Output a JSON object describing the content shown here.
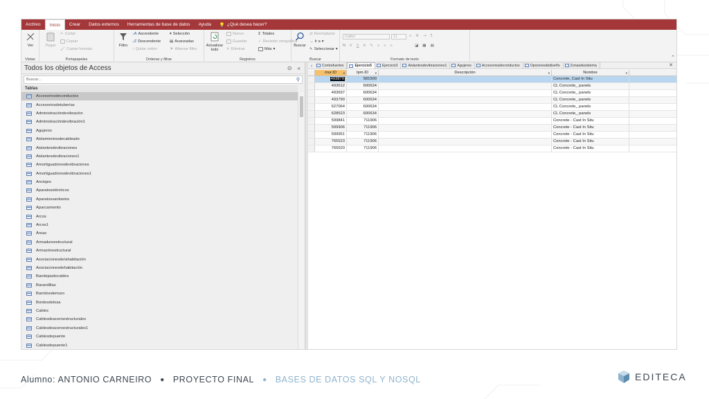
{
  "menubar": {
    "items": [
      "Archivo",
      "Inicio",
      "Crear",
      "Datos externos",
      "Herramientas de base de datos",
      "Ayuda"
    ],
    "active": "Inicio",
    "tell_me": "¿Qué desea hacer?"
  },
  "ribbon": {
    "vistas": {
      "label": "Vistas",
      "ver": "Ver"
    },
    "portapapeles": {
      "label": "Portapapeles",
      "pegar": "Pegar",
      "cortar": "Cortar",
      "copiar": "Copiar",
      "copiar_formato": "Copiar formato"
    },
    "ordenar": {
      "label": "Ordenar y filtrar",
      "filtro": "Filtro",
      "ascendente": "Ascendente",
      "descendente": "Descendente",
      "quitar_orden": "Quitar orden",
      "seleccion": "Selección",
      "avanzadas": "Avanzadas",
      "alternar_filtro": "Alternar filtro"
    },
    "registros": {
      "label": "Registros",
      "actualizar": "Actualizar",
      "todo": "todo",
      "nuevo": "Nuevo",
      "guardar": "Guardar",
      "eliminar": "Eliminar",
      "totales": "Totales",
      "revision": "Revisión ortográfica",
      "mas": "Más"
    },
    "buscar": {
      "label": "Buscar",
      "buscar": "Buscar",
      "reemplazar": "Reemplazar",
      "ir_a": "Ir a",
      "seleccionar": "Seleccionar"
    },
    "formato": {
      "label": "Formato de texto",
      "font": "Calibri",
      "size": "11",
      "n": "N",
      "k": "K",
      "s": "S",
      "a": "A"
    }
  },
  "nav": {
    "title": "Todos los objetos de Access",
    "search_placeholder": "Buscar...",
    "section": "Tablas",
    "items": [
      "Accesoriosdeconductos",
      "Accesoriosdetuberías",
      "Administracióndevibración",
      "Administracióndevibración1",
      "Agujeros",
      "Aislamientosdecableado",
      "Aislantesdevibraciones",
      "Aislantesdevibraciones1",
      "Amortiguadoresdevibraciones",
      "Amortiguadoresdevibraciones1",
      "Anclajes",
      "Aparatoseléctricos",
      "Aparatossanitarios",
      "Aparcamiento",
      "Arcos",
      "Arcos1",
      "Áreas",
      "Armadureestructural",
      "Armazónestructural",
      "Asociacionesde/ahabitación",
      "Asociacionesdehabitación",
      "Bandejasdecables",
      "Barandillas",
      "Barridosdemuro",
      "Bordesdelosa",
      "Cables",
      "Cablesdeaceroestructurales",
      "Cablesdeaceroestructurales1",
      "Cablesdepuente",
      "Cablesdepuente1"
    ],
    "selected": 0
  },
  "tabs": {
    "items": [
      "Contrafuertes",
      "Ejercicio5",
      "Ejercicio3",
      "Aislantesdevibraciones1",
      "Agujeros",
      "Accesoriosdeconductos",
      "Opcionesdediseño",
      "Zonasdesistema"
    ],
    "active": 1
  },
  "grid": {
    "columns": [
      "mur.ID",
      "tpm.ID",
      "Descripción",
      "Nombre"
    ],
    "rows": [
      [
        "493879",
        "581500",
        "",
        "Concrete, Cast In Situ"
      ],
      [
        "493612",
        "600634",
        "",
        "CL Concrete_ panels"
      ],
      [
        "493697",
        "600634",
        "",
        "CL Concrete_ panels"
      ],
      [
        "493790",
        "600634",
        "",
        "CL Concrete_ panels"
      ],
      [
        "627064",
        "600634",
        "",
        "CL Concrete_ panels"
      ],
      [
        "628523",
        "600634",
        "",
        "CL Concrete_ panels"
      ],
      [
        "599841",
        "711906",
        "",
        "Concrete - Cast In Situ"
      ],
      [
        "599906",
        "711906",
        "",
        "Concrete - Cast In Situ"
      ],
      [
        "599951",
        "711906",
        "",
        "Concrete - Cast In Situ"
      ],
      [
        "765523",
        "711906",
        "",
        "Concrete - Cast In Situ"
      ],
      [
        "765620",
        "711906",
        "",
        "Concrete - Cast In Situ"
      ]
    ]
  },
  "footer": {
    "alumno": "Alumno: ANTONIO CARNEIRO",
    "proyecto": "PROYECTO FINAL",
    "curso": "BASES DE DATOS SQL Y NOSQL",
    "logo": "EDITECA"
  },
  "colors": {
    "accent": "#a4373a",
    "selected_row": "#b9d6f0",
    "footer_text": "#3c4650",
    "footer_light": "#8fb3cd"
  }
}
